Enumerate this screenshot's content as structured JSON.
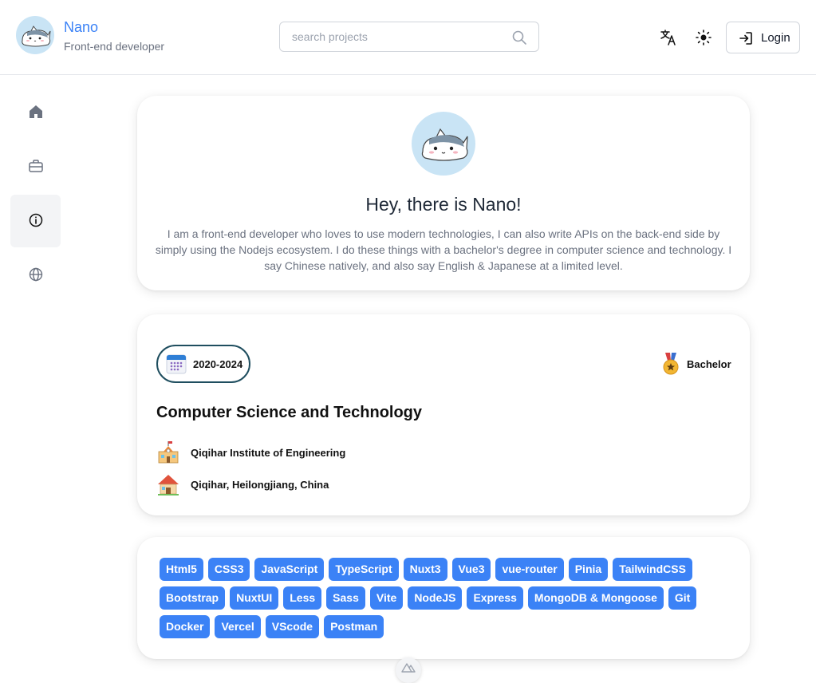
{
  "header": {
    "brand_name": "Nano",
    "brand_subtitle": "Front-end developer",
    "search_placeholder": "search projects",
    "login_label": "Login"
  },
  "sidebar": {
    "items": [
      {
        "name": "home",
        "icon": "home-icon",
        "active": false
      },
      {
        "name": "projects",
        "icon": "briefcase-icon",
        "active": false
      },
      {
        "name": "about",
        "icon": "info-icon",
        "active": true
      },
      {
        "name": "world",
        "icon": "globe-icon",
        "active": false
      }
    ]
  },
  "profile": {
    "greeting": "Hey, there is Nano!",
    "bio": "I am a front-end developer who loves to use modern technologies, I can also write APIs on the back-end side by simply using the Nodejs ecosystem. I do these things with a bachelor's degree in computer science and technology. I say Chinese natively, and also say English & Japanese at a limited level."
  },
  "education": {
    "period": "2020-2024",
    "degree": "Bachelor",
    "major": "Computer Science and Technology",
    "school": "Qiqihar Institute of Engineering",
    "location": "Qiqihar, Heilongjiang, China"
  },
  "skills": {
    "tags": [
      "Html5",
      "CSS3",
      "JavaScript",
      "TypeScript",
      "Nuxt3",
      "Vue3",
      "vue-router",
      "Pinia",
      "TailwindCSS",
      "Bootstrap",
      "NuxtUI",
      "Less",
      "Sass",
      "Vite",
      "NodeJS",
      "Express",
      "MongoDB & Mongoose",
      "Git",
      "Docker",
      "Vercel",
      "VScode",
      "Postman"
    ]
  },
  "colors": {
    "accent": "#3b82f6",
    "pill_border": "#1f4e5f",
    "avatar_bg": "#c9e4f5"
  }
}
